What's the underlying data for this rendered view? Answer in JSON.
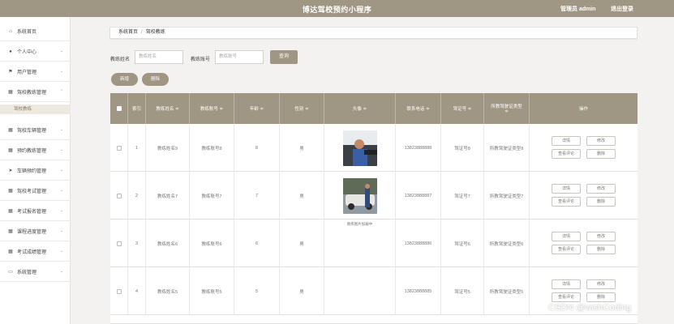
{
  "header": {
    "title": "博达驾校预约小程序",
    "admin_label": "管理员 admin",
    "logout_label": "退出登录"
  },
  "sidebar": {
    "items": [
      {
        "icon": "home-icon",
        "glyph": "⌂",
        "label": "系统首页",
        "has_chevron": false
      },
      {
        "icon": "user-icon",
        "glyph": "●",
        "label": "个人中心",
        "has_chevron": true
      },
      {
        "icon": "flag-icon",
        "glyph": "⚑",
        "label": "用户管理",
        "has_chevron": true
      },
      {
        "icon": "grid-icon",
        "glyph": "▦",
        "label": "驾校教练管理",
        "has_chevron": true
      },
      {
        "icon": "grid-icon",
        "glyph": "▦",
        "label": "驾校车辆管理",
        "has_chevron": true
      },
      {
        "icon": "grid-icon",
        "glyph": "▦",
        "label": "预约教练管理",
        "has_chevron": true
      },
      {
        "icon": "send-icon",
        "glyph": "➤",
        "label": "车辆预约管理",
        "has_chevron": true
      },
      {
        "icon": "grid-icon",
        "glyph": "▦",
        "label": "驾校考试管理",
        "has_chevron": true
      },
      {
        "icon": "grid-icon",
        "glyph": "▦",
        "label": "考试报名管理",
        "has_chevron": true
      },
      {
        "icon": "grid-icon",
        "glyph": "▦",
        "label": "课程进度管理",
        "has_chevron": true
      },
      {
        "icon": "grid-icon",
        "glyph": "▦",
        "label": "考试成绩管理",
        "has_chevron": true
      },
      {
        "icon": "desktop-icon",
        "glyph": "▭",
        "label": "系统管理",
        "has_chevron": true
      }
    ],
    "active_submenu": "驾校教练"
  },
  "breadcrumb": {
    "home": "系统首页",
    "separator": "/",
    "current": "驾校教练"
  },
  "search": {
    "name_label": "教练姓名",
    "name_placeholder": "教练姓名",
    "number_label": "教练账号",
    "number_placeholder": "教练账号",
    "button": "查询"
  },
  "actions": {
    "add": "新增",
    "delete": "删除"
  },
  "table": {
    "headers": [
      "",
      "索引",
      "教练姓名 ≑",
      "教练账号 ≑",
      "年龄 ≑",
      "性别 ≑",
      "头像 ≑",
      "联系电话 ≑",
      "驾证号 ≑",
      "所教驾驶证类型 ≑",
      "操作"
    ],
    "row_actions": {
      "detail": "详情",
      "edit": "修改",
      "comments": "查看评论",
      "delete": "删除"
    },
    "rows": [
      {
        "index": "1",
        "name": "教练姓名9",
        "account": "教练账号8",
        "age": "8",
        "gender": "男",
        "photo": "driver-in-car",
        "photo_caption": "",
        "phone": "13823888888",
        "license": "驾证号8",
        "license_type": "所教驾驶证类型8"
      },
      {
        "index": "2",
        "name": "教练姓名7",
        "account": "教练账号7",
        "age": "7",
        "gender": "男",
        "photo": "instructor-with-car",
        "photo_caption": "",
        "phone": "13823888887",
        "license": "驾证号7",
        "license_type": "所教驾驶证类型7"
      },
      {
        "index": "3",
        "name": "教练姓名6",
        "account": "教练账号6",
        "age": "6",
        "gender": "男",
        "photo": "none",
        "photo_caption": "教练图片加载中",
        "phone": "13823888886",
        "license": "驾证号6",
        "license_type": "所教驾驶证类型6"
      },
      {
        "index": "4",
        "name": "教练姓名5",
        "account": "教练账号5",
        "age": "5",
        "gender": "男",
        "photo": "none",
        "photo_caption": "",
        "phone": "13823888885",
        "license": "驾证号5",
        "license_type": "所教驾驶证类型5"
      }
    ]
  },
  "watermark": "CSDN @wishCoding",
  "colors": {
    "accent": "#a09684",
    "background": "#f3f2f0",
    "sidebar_active": "#ede9e1"
  }
}
